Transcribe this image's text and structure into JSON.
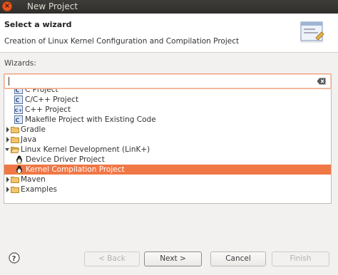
{
  "window": {
    "title": "New Project"
  },
  "header": {
    "title": "Select a wizard",
    "description": "Creation of Linux Kernel Configuration and Compilation Project"
  },
  "wizards_label": "Wizards:",
  "filter": {
    "value": ""
  },
  "tree": {
    "items": [
      {
        "label": "C Project",
        "icon": "c-project-icon"
      },
      {
        "label": "C/C++ Project",
        "icon": "c-project-icon"
      },
      {
        "label": "C++ Project",
        "icon": "cpp-project-icon"
      },
      {
        "label": "Makefile Project with Existing Code",
        "icon": "c-project-icon"
      },
      {
        "label": "Gradle",
        "icon": "folder-icon",
        "expanded": false
      },
      {
        "label": "Java",
        "icon": "folder-icon",
        "expanded": false
      },
      {
        "label": "Linux Kernel Development (LinK+)",
        "icon": "folder-open-icon",
        "expanded": true
      },
      {
        "label": "Device Driver Project",
        "icon": "tux-icon"
      },
      {
        "label": "Kernel Compilation Project",
        "icon": "tux-icon",
        "selected": true
      },
      {
        "label": "Maven",
        "icon": "folder-icon",
        "expanded": false
      },
      {
        "label": "Examples",
        "icon": "folder-icon",
        "expanded": false
      }
    ]
  },
  "buttons": {
    "back": "< Back",
    "next": "Next >",
    "cancel": "Cancel",
    "finish": "Finish"
  }
}
